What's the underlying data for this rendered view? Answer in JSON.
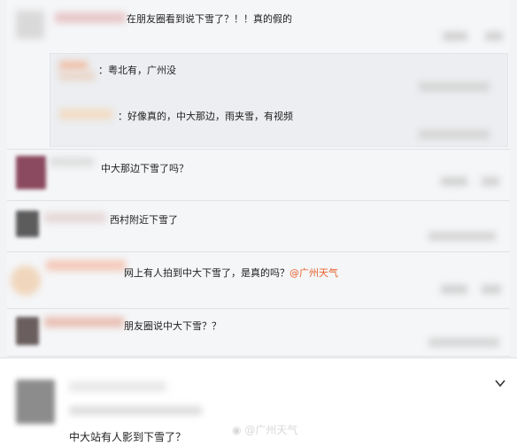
{
  "comments": [
    {
      "text": "在朋友圈看到说下雪了？！！真的假的"
    },
    {
      "text": "中大那边下雪了吗？"
    },
    {
      "text": "西村附近下雪了"
    },
    {
      "text": "网上有人拍到中大下雪了，是真的吗？",
      "mention": "@广州天气"
    },
    {
      "text": "朋友圈说中大下雪？？"
    }
  ],
  "replies": [
    {
      "text": "：粤北有，广州没"
    },
    {
      "text": "：好像真的，中大那边，雨夹雪，有视频"
    }
  ],
  "bottom": {
    "text": "中大站有人影到下雪了？"
  },
  "watermark": {
    "text": "@广州天气"
  },
  "colors": {
    "mention": "#e8622b",
    "background": "#f2f3f5"
  }
}
